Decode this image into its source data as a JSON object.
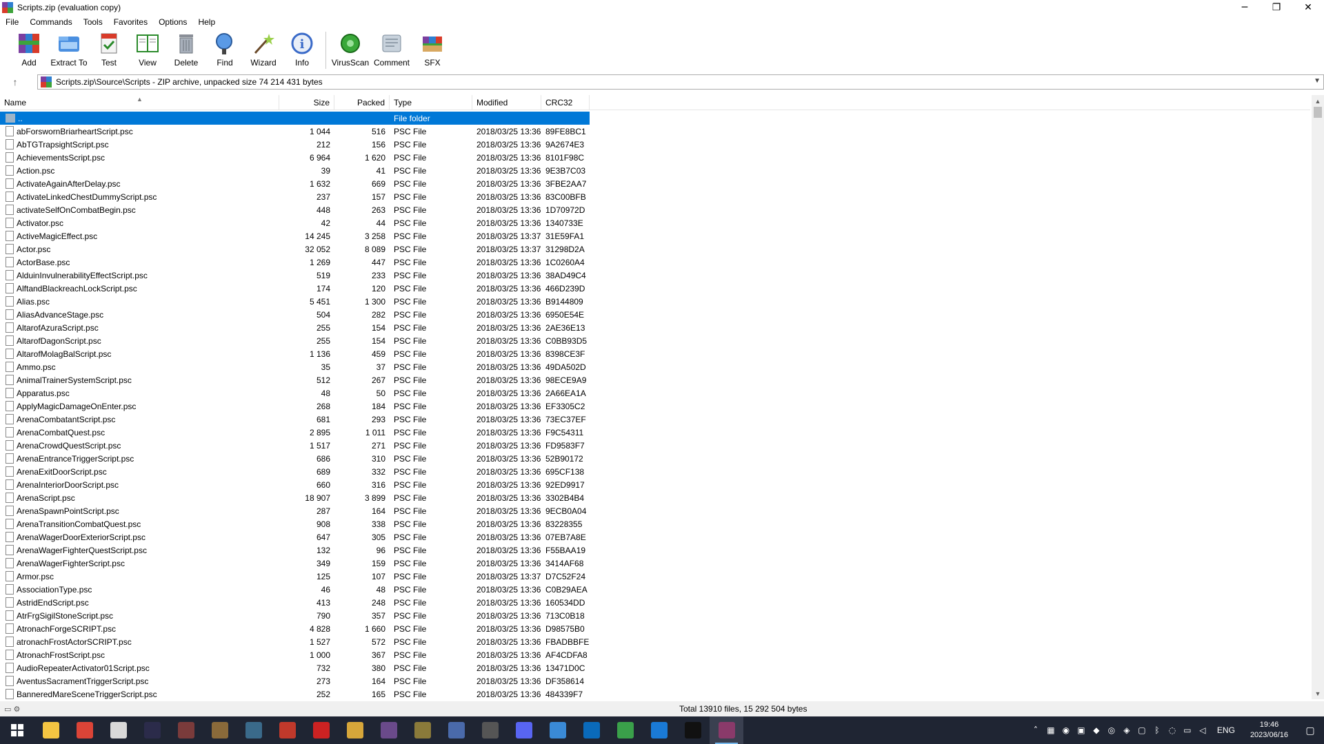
{
  "window": {
    "title": "Scripts.zip (evaluation copy)",
    "minimize": "─",
    "maximize": "❐",
    "close": "✕"
  },
  "menu": [
    "File",
    "Commands",
    "Tools",
    "Favorites",
    "Options",
    "Help"
  ],
  "toolbar": [
    {
      "label": "Add",
      "icon": "add-archive-icon"
    },
    {
      "label": "Extract To",
      "icon": "extract-icon"
    },
    {
      "label": "Test",
      "icon": "test-icon"
    },
    {
      "label": "View",
      "icon": "view-icon"
    },
    {
      "label": "Delete",
      "icon": "delete-icon"
    },
    {
      "label": "Find",
      "icon": "find-icon"
    },
    {
      "label": "Wizard",
      "icon": "wizard-icon"
    },
    {
      "label": "Info",
      "icon": "info-icon"
    },
    {
      "label": "VirusScan",
      "icon": "virusscan-icon"
    },
    {
      "label": "Comment",
      "icon": "comment-icon"
    },
    {
      "label": "SFX",
      "icon": "sfx-icon"
    }
  ],
  "address": {
    "path": "Scripts.zip\\Source\\Scripts - ZIP archive, unpacked size 74 214 431 bytes"
  },
  "columns": {
    "name": "Name",
    "size": "Size",
    "packed": "Packed",
    "type": "Type",
    "modified": "Modified",
    "crc": "CRC32"
  },
  "parent_row": {
    "name": "..",
    "type": "File folder"
  },
  "files": [
    {
      "name": "abForswornBriarheartScript.psc",
      "size": "1 044",
      "packed": "516",
      "type": "PSC File",
      "modified": "2018/03/25 13:36",
      "crc": "89FE8BC1"
    },
    {
      "name": "AbTGTrapsightScript.psc",
      "size": "212",
      "packed": "156",
      "type": "PSC File",
      "modified": "2018/03/25 13:36",
      "crc": "9A2674E3"
    },
    {
      "name": "AchievementsScript.psc",
      "size": "6 964",
      "packed": "1 620",
      "type": "PSC File",
      "modified": "2018/03/25 13:36",
      "crc": "8101F98C"
    },
    {
      "name": "Action.psc",
      "size": "39",
      "packed": "41",
      "type": "PSC File",
      "modified": "2018/03/25 13:36",
      "crc": "9E3B7C03"
    },
    {
      "name": "ActivateAgainAfterDelay.psc",
      "size": "1 632",
      "packed": "669",
      "type": "PSC File",
      "modified": "2018/03/25 13:36",
      "crc": "3FBE2AA7"
    },
    {
      "name": "ActivateLinkedChestDummyScript.psc",
      "size": "237",
      "packed": "157",
      "type": "PSC File",
      "modified": "2018/03/25 13:36",
      "crc": "83C00BFB"
    },
    {
      "name": "activateSelfOnCombatBegin.psc",
      "size": "448",
      "packed": "263",
      "type": "PSC File",
      "modified": "2018/03/25 13:36",
      "crc": "1D70972D"
    },
    {
      "name": "Activator.psc",
      "size": "42",
      "packed": "44",
      "type": "PSC File",
      "modified": "2018/03/25 13:36",
      "crc": "1340733E"
    },
    {
      "name": "ActiveMagicEffect.psc",
      "size": "14 245",
      "packed": "3 258",
      "type": "PSC File",
      "modified": "2018/03/25 13:37",
      "crc": "31E59FA1"
    },
    {
      "name": "Actor.psc",
      "size": "32 052",
      "packed": "8 089",
      "type": "PSC File",
      "modified": "2018/03/25 13:37",
      "crc": "31298D2A"
    },
    {
      "name": "ActorBase.psc",
      "size": "1 269",
      "packed": "447",
      "type": "PSC File",
      "modified": "2018/03/25 13:36",
      "crc": "1C0260A4"
    },
    {
      "name": "AlduinInvulnerabilityEffectScript.psc",
      "size": "519",
      "packed": "233",
      "type": "PSC File",
      "modified": "2018/03/25 13:36",
      "crc": "38AD49C4"
    },
    {
      "name": "AlftandBlackreachLockScript.psc",
      "size": "174",
      "packed": "120",
      "type": "PSC File",
      "modified": "2018/03/25 13:36",
      "crc": "466D239D"
    },
    {
      "name": "Alias.psc",
      "size": "5 451",
      "packed": "1 300",
      "type": "PSC File",
      "modified": "2018/03/25 13:36",
      "crc": "B9144809"
    },
    {
      "name": "AliasAdvanceStage.psc",
      "size": "504",
      "packed": "282",
      "type": "PSC File",
      "modified": "2018/03/25 13:36",
      "crc": "6950E54E"
    },
    {
      "name": "AltarofAzuraScript.psc",
      "size": "255",
      "packed": "154",
      "type": "PSC File",
      "modified": "2018/03/25 13:36",
      "crc": "2AE36E13"
    },
    {
      "name": "AltarofDagonScript.psc",
      "size": "255",
      "packed": "154",
      "type": "PSC File",
      "modified": "2018/03/25 13:36",
      "crc": "C0BB93D5"
    },
    {
      "name": "AltarofMolagBalScript.psc",
      "size": "1 136",
      "packed": "459",
      "type": "PSC File",
      "modified": "2018/03/25 13:36",
      "crc": "8398CE3F"
    },
    {
      "name": "Ammo.psc",
      "size": "35",
      "packed": "37",
      "type": "PSC File",
      "modified": "2018/03/25 13:36",
      "crc": "49DA502D"
    },
    {
      "name": "AnimalTrainerSystemScript.psc",
      "size": "512",
      "packed": "267",
      "type": "PSC File",
      "modified": "2018/03/25 13:36",
      "crc": "98ECE9A9"
    },
    {
      "name": "Apparatus.psc",
      "size": "48",
      "packed": "50",
      "type": "PSC File",
      "modified": "2018/03/25 13:36",
      "crc": "2A66EA1A"
    },
    {
      "name": "ApplyMagicDamageOnEnter.psc",
      "size": "268",
      "packed": "184",
      "type": "PSC File",
      "modified": "2018/03/25 13:36",
      "crc": "EF3305C2"
    },
    {
      "name": "ArenaCombatantScript.psc",
      "size": "681",
      "packed": "293",
      "type": "PSC File",
      "modified": "2018/03/25 13:36",
      "crc": "73EC37EF"
    },
    {
      "name": "ArenaCombatQuest.psc",
      "size": "2 895",
      "packed": "1 011",
      "type": "PSC File",
      "modified": "2018/03/25 13:36",
      "crc": "F9C54311"
    },
    {
      "name": "ArenaCrowdQuestScript.psc",
      "size": "1 517",
      "packed": "271",
      "type": "PSC File",
      "modified": "2018/03/25 13:36",
      "crc": "FD9583F7"
    },
    {
      "name": "ArenaEntranceTriggerScript.psc",
      "size": "686",
      "packed": "310",
      "type": "PSC File",
      "modified": "2018/03/25 13:36",
      "crc": "52B90172"
    },
    {
      "name": "ArenaExitDoorScript.psc",
      "size": "689",
      "packed": "332",
      "type": "PSC File",
      "modified": "2018/03/25 13:36",
      "crc": "695CF138"
    },
    {
      "name": "ArenaInteriorDoorScript.psc",
      "size": "660",
      "packed": "316",
      "type": "PSC File",
      "modified": "2018/03/25 13:36",
      "crc": "92ED9917"
    },
    {
      "name": "ArenaScript.psc",
      "size": "18 907",
      "packed": "3 899",
      "type": "PSC File",
      "modified": "2018/03/25 13:36",
      "crc": "3302B4B4"
    },
    {
      "name": "ArenaSpawnPointScript.psc",
      "size": "287",
      "packed": "164",
      "type": "PSC File",
      "modified": "2018/03/25 13:36",
      "crc": "9ECB0A04"
    },
    {
      "name": "ArenaTransitionCombatQuest.psc",
      "size": "908",
      "packed": "338",
      "type": "PSC File",
      "modified": "2018/03/25 13:36",
      "crc": "83228355"
    },
    {
      "name": "ArenaWagerDoorExteriorScript.psc",
      "size": "647",
      "packed": "305",
      "type": "PSC File",
      "modified": "2018/03/25 13:36",
      "crc": "07EB7A8E"
    },
    {
      "name": "ArenaWagerFighterQuestScript.psc",
      "size": "132",
      "packed": "96",
      "type": "PSC File",
      "modified": "2018/03/25 13:36",
      "crc": "F55BAA19"
    },
    {
      "name": "ArenaWagerFighterScript.psc",
      "size": "349",
      "packed": "159",
      "type": "PSC File",
      "modified": "2018/03/25 13:36",
      "crc": "3414AF68"
    },
    {
      "name": "Armor.psc",
      "size": "125",
      "packed": "107",
      "type": "PSC File",
      "modified": "2018/03/25 13:37",
      "crc": "D7C52F24"
    },
    {
      "name": "AssociationType.psc",
      "size": "46",
      "packed": "48",
      "type": "PSC File",
      "modified": "2018/03/25 13:36",
      "crc": "C0B29AEA"
    },
    {
      "name": "AstridEndScript.psc",
      "size": "413",
      "packed": "248",
      "type": "PSC File",
      "modified": "2018/03/25 13:36",
      "crc": "160534DD"
    },
    {
      "name": "AtrFrgSigilStoneScript.psc",
      "size": "790",
      "packed": "357",
      "type": "PSC File",
      "modified": "2018/03/25 13:36",
      "crc": "713C0B18"
    },
    {
      "name": "AtronachForgeSCRIPT.psc",
      "size": "4 828",
      "packed": "1 660",
      "type": "PSC File",
      "modified": "2018/03/25 13:36",
      "crc": "D98575B0"
    },
    {
      "name": "atronachFrostActorSCRIPT.psc",
      "size": "1 527",
      "packed": "572",
      "type": "PSC File",
      "modified": "2018/03/25 13:36",
      "crc": "FBADBBFE"
    },
    {
      "name": "AtronachFrostScript.psc",
      "size": "1 000",
      "packed": "367",
      "type": "PSC File",
      "modified": "2018/03/25 13:36",
      "crc": "AF4CDFA8"
    },
    {
      "name": "AudioRepeaterActivator01Script.psc",
      "size": "732",
      "packed": "380",
      "type": "PSC File",
      "modified": "2018/03/25 13:36",
      "crc": "13471D0C"
    },
    {
      "name": "AventusSacramentTriggerScript.psc",
      "size": "273",
      "packed": "164",
      "type": "PSC File",
      "modified": "2018/03/25 13:36",
      "crc": "DF358614"
    },
    {
      "name": "BanneredMareSceneTriggerScript.psc",
      "size": "252",
      "packed": "165",
      "type": "PSC File",
      "modified": "2018/03/25 13:36",
      "crc": "484339F7"
    }
  ],
  "status": {
    "text": "Total 13910 files, 15 292 504 bytes"
  },
  "taskbar": {
    "apps": [
      {
        "name": "file-explorer",
        "color": "#f4c542"
      },
      {
        "name": "chrome",
        "color": "#db4437"
      },
      {
        "name": "app-3",
        "color": "#d9d9d9"
      },
      {
        "name": "app-4",
        "color": "#2b2b4a"
      },
      {
        "name": "app-5",
        "color": "#7a3b3b"
      },
      {
        "name": "app-6",
        "color": "#8a6a3a"
      },
      {
        "name": "app-7",
        "color": "#3a6a8a"
      },
      {
        "name": "app-8",
        "color": "#c0392b"
      },
      {
        "name": "app-9",
        "color": "#cc2222"
      },
      {
        "name": "app-10",
        "color": "#d6a63a"
      },
      {
        "name": "app-11",
        "color": "#6a4a8a"
      },
      {
        "name": "app-12",
        "color": "#8a7a3a"
      },
      {
        "name": "app-13",
        "color": "#4a6aaa"
      },
      {
        "name": "app-14",
        "color": "#555555"
      },
      {
        "name": "discord",
        "color": "#5865f2"
      },
      {
        "name": "store",
        "color": "#3a8ad6"
      },
      {
        "name": "app-17",
        "color": "#0a6aba"
      },
      {
        "name": "app-18",
        "color": "#3aa04a"
      },
      {
        "name": "app-19",
        "color": "#1a7ad6"
      },
      {
        "name": "terminal",
        "color": "#111111"
      },
      {
        "name": "winrar",
        "color": "#8a3a6a"
      }
    ],
    "language": "ENG",
    "time": "19:46",
    "date": "2023/06/16"
  }
}
